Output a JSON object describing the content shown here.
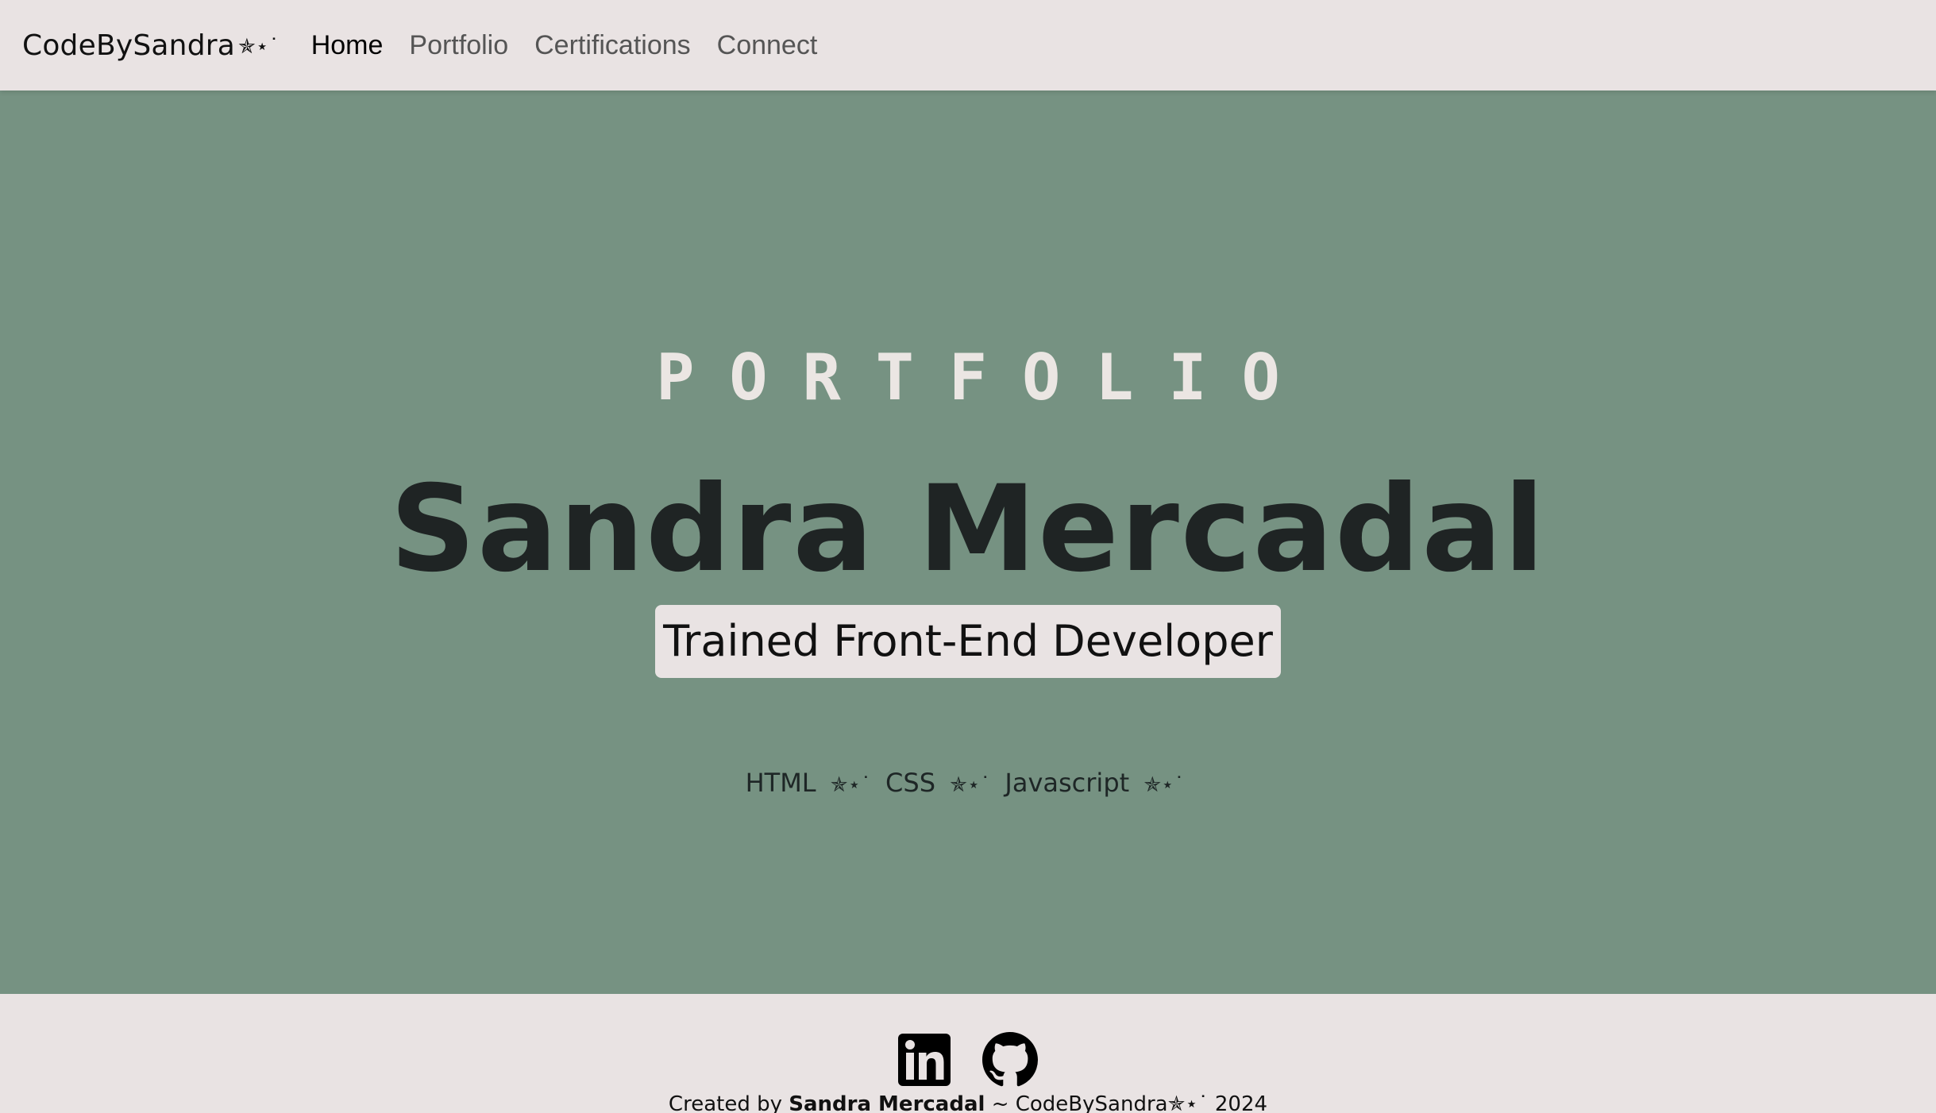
{
  "navbar": {
    "brand": "CodeBySandra",
    "brand_sparkle": "✯⋆˙",
    "links": [
      {
        "label": "Home",
        "active": true
      },
      {
        "label": "Portfolio",
        "active": false
      },
      {
        "label": "Certifications",
        "active": false
      },
      {
        "label": "Connect",
        "active": false
      }
    ]
  },
  "hero": {
    "kicker": "PORTFOLIO",
    "name": "Sandra Mercadal",
    "role": "Trained Front-End Developer",
    "skills": [
      "HTML",
      "CSS",
      "Javascript"
    ],
    "skill_separator": "✯⋆˙",
    "background_color": "#769282"
  },
  "footer": {
    "social": [
      {
        "name": "LinkedIn",
        "icon": "linkedin-icon"
      },
      {
        "name": "GitHub",
        "icon": "github-icon"
      }
    ],
    "credits_prefix": "Created by",
    "credits_author": "Sandra Mercadal",
    "credits_suffix": "~ CodeBySandra✯⋆˙ 2024"
  }
}
